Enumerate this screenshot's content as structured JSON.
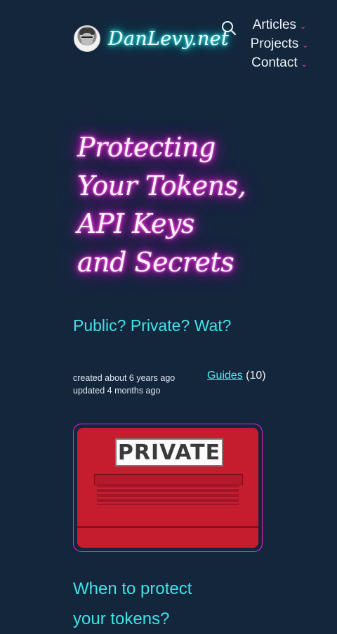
{
  "header": {
    "site_name": "DanLevy.net",
    "nav": [
      {
        "label": "Articles",
        "chevron": "⌄"
      },
      {
        "label": "Projects",
        "chevron": "⌄"
      },
      {
        "label": "Contact",
        "chevron": "⌄"
      }
    ],
    "icons": {
      "search": "search-icon",
      "menu_chevron": "chevron-down-icon"
    }
  },
  "article": {
    "title_lines": [
      "Protecting",
      "Your Tokens,",
      "API Keys",
      "and Secrets"
    ],
    "subtitle": "Public? Private? Wat?",
    "meta": {
      "created": "created about 6 years ago",
      "updated": "updated 4 months ago"
    },
    "tag": {
      "label": "Guides",
      "count": "(10)"
    },
    "hero_image": {
      "sign_text": "PRIVATE"
    },
    "section_heading": "When to protect your tokens?"
  },
  "colors": {
    "background": "#13263c",
    "neon_pink": "#ff2ee3",
    "neon_cyan": "#1ee",
    "accent_cyan": "#3fe3e8"
  }
}
